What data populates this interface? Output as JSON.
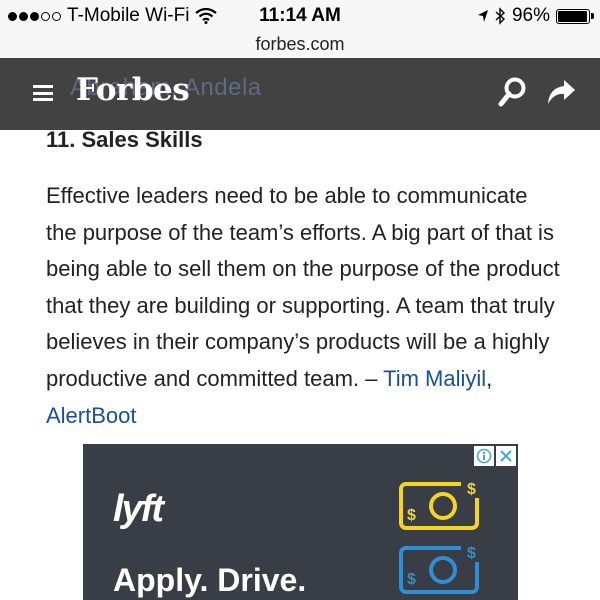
{
  "status_bar": {
    "carrier": "T-Mobile Wi-Fi",
    "time": "11:14 AM",
    "battery": "96%",
    "battery_level": 0.96
  },
  "browser": {
    "url": "forbes.com"
  },
  "header": {
    "logo": "Forbes",
    "behind_text": "Abraham, Andela",
    "icons": [
      "menu-icon",
      "search-icon",
      "share-icon"
    ],
    "background": "#323232"
  },
  "article": {
    "heading": "11. Sales Skills",
    "body": "Effective leaders need to be able to communicate the purpose of the team’s efforts. A big part of that is being able to sell them on the purpose of the product that they are building or supporting. A team that truly believes in their company’s products will be a highly productive and committed team. – ",
    "author_link": "Tim Maliyil",
    "separator": ", ",
    "company_link": "AlertBoot",
    "link_color": "#1a4f9c"
  },
  "ad": {
    "brand": "lyft",
    "cta": "Apply. Drive.",
    "background": "#393e46",
    "accent_yellow": "#f5d51f",
    "accent_blue": "#2e8fd4",
    "icons": [
      "adchoices-icon",
      "close-icon",
      "money-icon"
    ]
  }
}
